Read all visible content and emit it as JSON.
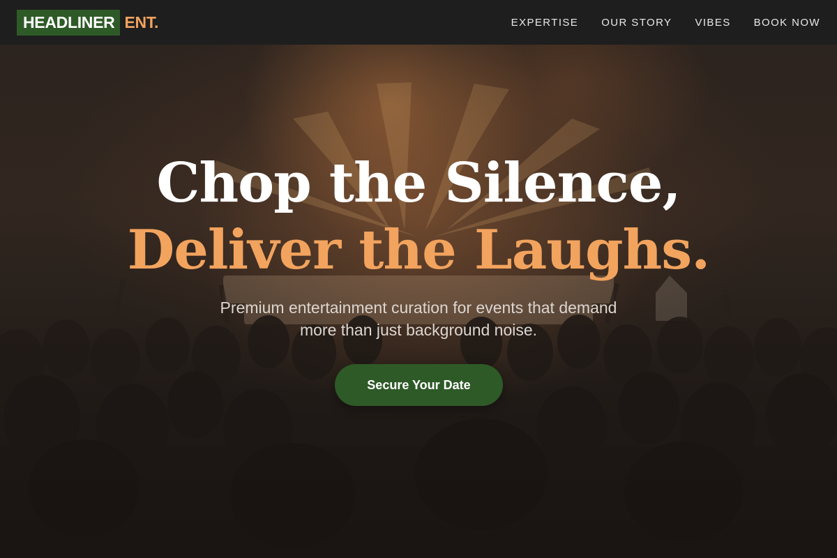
{
  "brand": {
    "name": "HEADLINER",
    "suffix": "ENT."
  },
  "nav": {
    "items": [
      {
        "label": "EXPERTISE"
      },
      {
        "label": "OUR STORY"
      },
      {
        "label": "VIBES"
      },
      {
        "label": "BOOK NOW"
      }
    ]
  },
  "hero": {
    "headline_line_1": "Chop the Silence,",
    "headline_line_2": "Deliver the Laughs.",
    "tagline": "Premium entertainment curation for events that demand more than just background noise.",
    "cta_label": "Secure Your Date"
  },
  "colors": {
    "nav_background": "#1e1e1e",
    "brand_green": "#2e5a27",
    "accent_orange": "#f2a35e",
    "hero_dark": "#221c19"
  }
}
